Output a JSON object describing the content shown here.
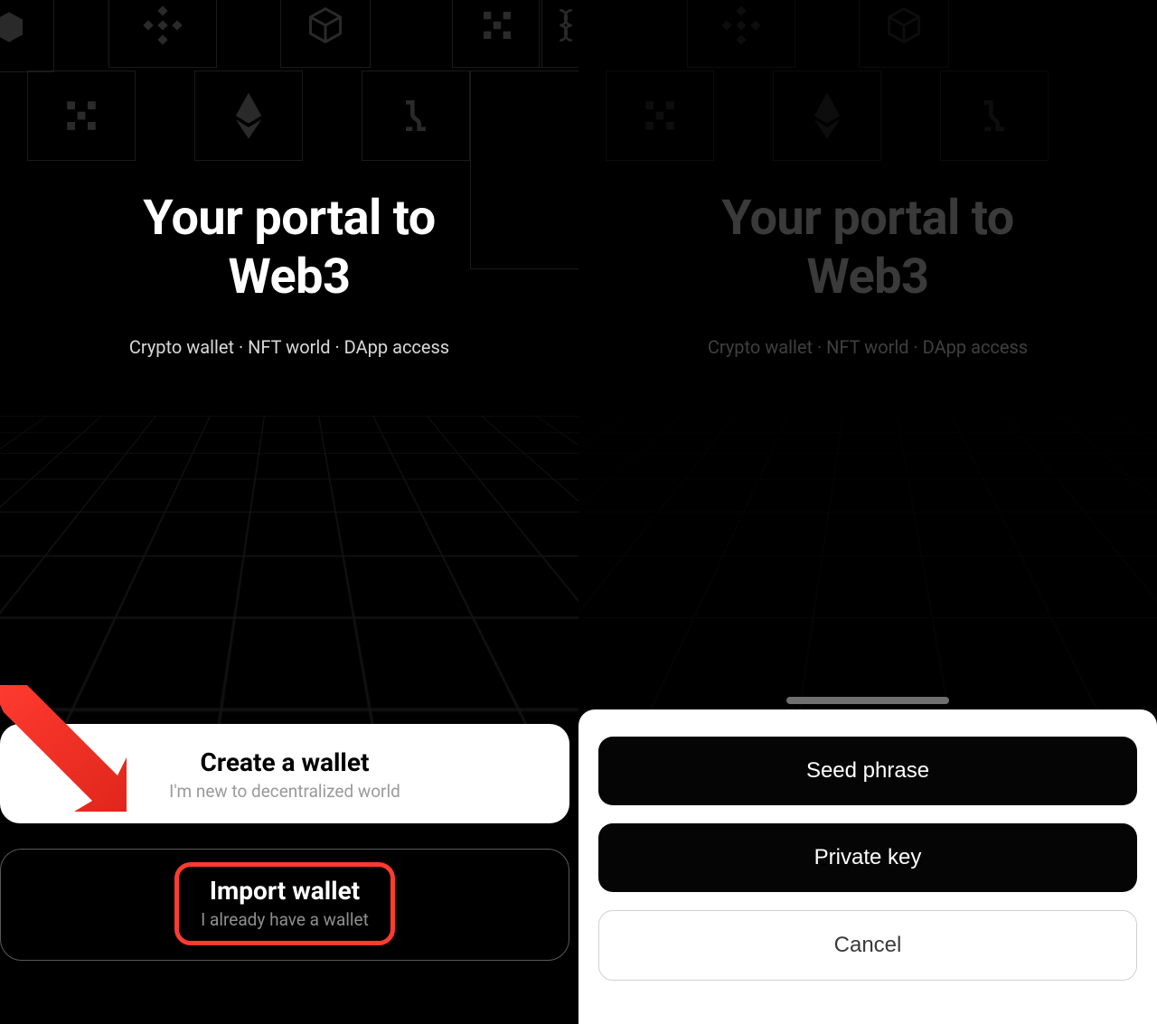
{
  "hero": {
    "title_line1": "Your portal to",
    "title_line2": "Web3",
    "subtitle": "Crypto wallet · NFT world · DApp access"
  },
  "cards": {
    "create": {
      "title": "Create a wallet",
      "sub": "I'm new to decentralized world"
    },
    "import": {
      "title": "Import wallet",
      "sub": "I already have a wallet"
    }
  },
  "sheet": {
    "seed": "Seed phrase",
    "private_key": "Private key",
    "cancel": "Cancel"
  },
  "icons": {
    "hexagon": "hexagon-icon",
    "binance": "binance-icon",
    "cube": "cube-icon",
    "pixel": "pixel-icon",
    "link": "link-icon",
    "pixel2": "pixel-icon",
    "eth": "ethereum-icon",
    "connector": "connector-icon"
  },
  "annotation": {
    "highlight_color": "#ff3b30"
  }
}
